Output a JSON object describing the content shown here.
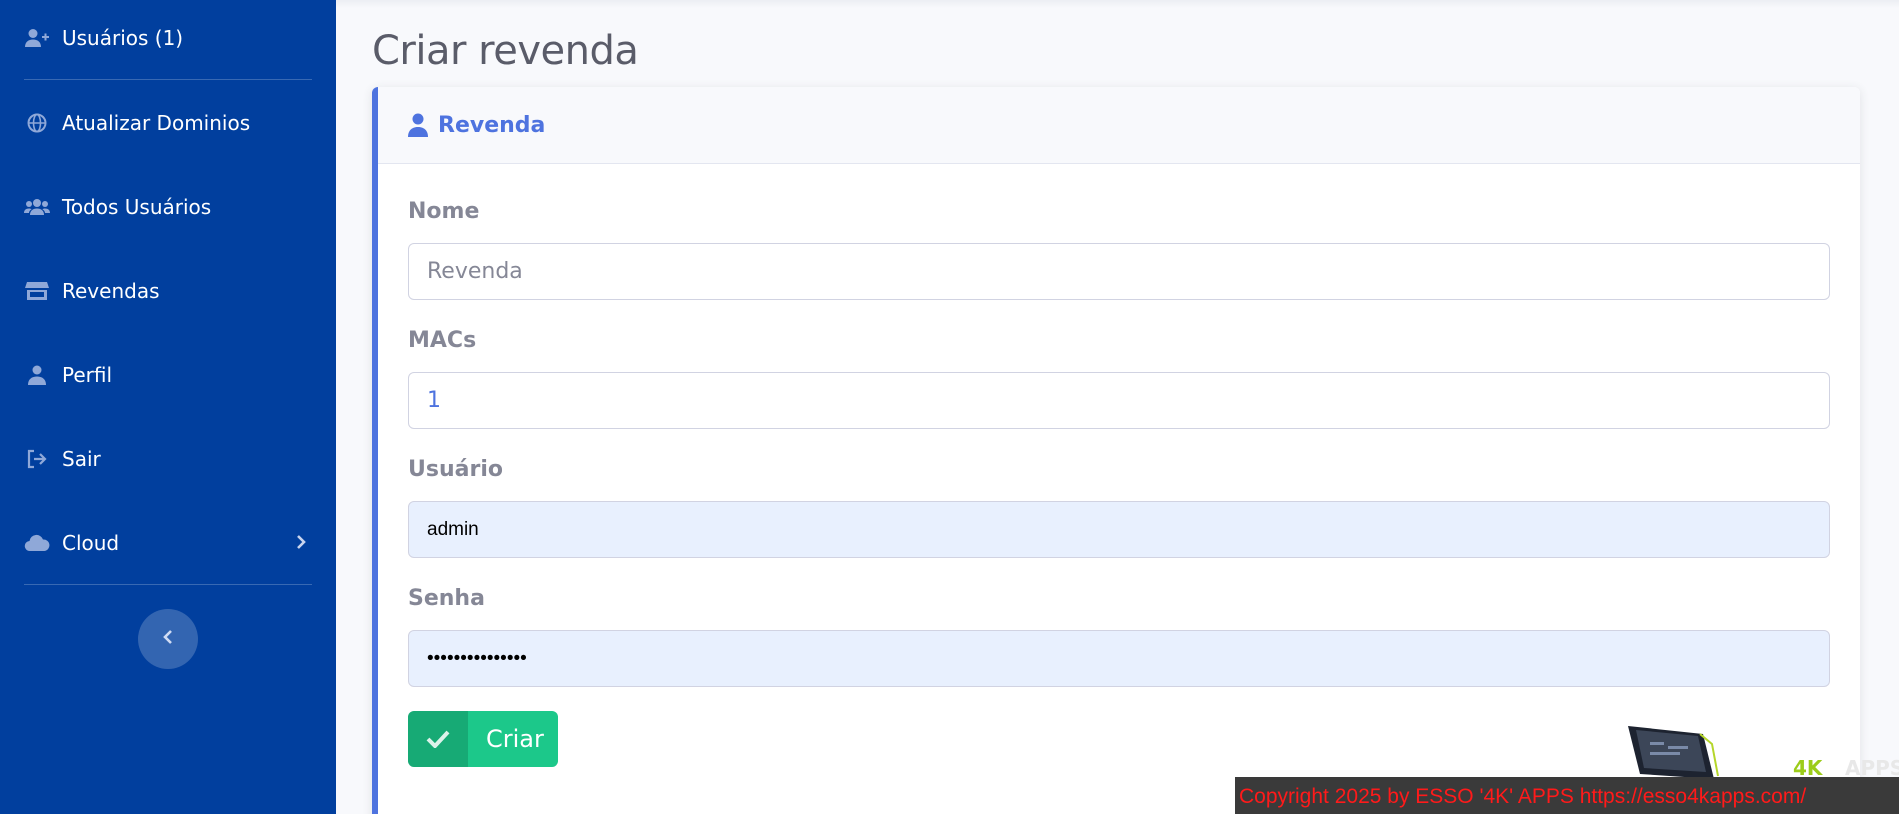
{
  "sidebar": {
    "items": [
      {
        "label": "Usuários (1)",
        "icon": "user-plus-icon"
      },
      {
        "label": "Atualizar Dominios",
        "icon": "globe-icon"
      },
      {
        "label": "Todos Usuários",
        "icon": "users-icon"
      },
      {
        "label": "Revendas",
        "icon": "store-icon"
      },
      {
        "label": "Perfil",
        "icon": "user-icon"
      },
      {
        "label": "Sair",
        "icon": "sign-out-icon"
      },
      {
        "label": "Cloud",
        "icon": "cloud-icon"
      }
    ],
    "toggle_icon": "chevron-left-icon"
  },
  "page": {
    "title": "Criar revenda"
  },
  "card": {
    "header_title": "Revenda",
    "header_icon": "user-icon"
  },
  "form": {
    "nome_label": "Nome",
    "nome_placeholder": "Revenda",
    "macs_label": "MACs",
    "macs_value": "1",
    "usuario_label": "Usuário",
    "usuario_value": "admin",
    "senha_label": "Senha",
    "senha_value": "•••••••••••••••",
    "submit_label": "Criar"
  },
  "footer": {
    "watermark_brand": "4K",
    "watermark_suffix": "APPS",
    "copyright": "Copyright 2025  by ESSO '4K' APPS https://esso4kapps.com/"
  },
  "colors": {
    "sidebar_bg": "#013f9e",
    "primary": "#4e73df",
    "success": "#1cc88a",
    "copyright_text": "#ff1a1a"
  }
}
